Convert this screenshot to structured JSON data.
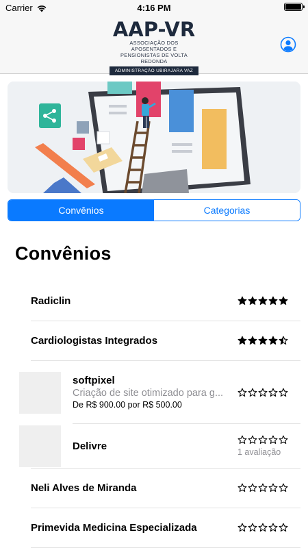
{
  "status_bar": {
    "carrier": "Carrier",
    "time": "4:16 PM",
    "battery_level": 1.0
  },
  "header": {
    "logo": {
      "title": "AAP-VR",
      "subtitle_line1": "ASSOCIAÇÃO DOS APOSENTADOS E",
      "subtitle_line2": "PENSIONISTAS DE VOLTA REDONDA",
      "admin": "ADMINISTRAÇÃO UBIRAJARA VAZ"
    },
    "profile_icon": "user-circle-icon"
  },
  "tabs": [
    {
      "label": "Convênios",
      "selected": true
    },
    {
      "label": "Categorias",
      "selected": false
    }
  ],
  "section_title": "Convênios",
  "colors": {
    "accent": "#0a7aff",
    "text_secondary": "#8e8e93"
  },
  "list": [
    {
      "name": "Radiclin",
      "rating": 5
    },
    {
      "name": "Cardiologistas Integrados",
      "rating": 4.5
    },
    {
      "name": "softpixel",
      "description": "Criação de site otimizado para g...",
      "price": "De R$ 900.00 por R$ 500.00",
      "rating": 0,
      "has_thumbnail": true
    },
    {
      "name": "Delivre",
      "rating": 0,
      "rating_count": "1 avaliação",
      "has_thumbnail": true
    },
    {
      "name": "Neli Alves de Miranda",
      "rating": 0
    },
    {
      "name": "Primevida Medicina Especializada",
      "rating": 0
    }
  ]
}
